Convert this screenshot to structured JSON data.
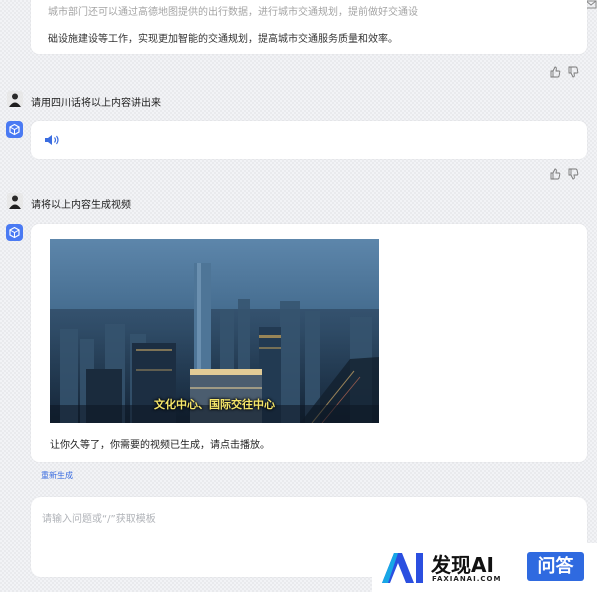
{
  "prev_reply": {
    "line1": "城市部门还可以通过高德地图提供的出行数据，进行城市交通规划，提前做好交通设",
    "line2": "础设施建设等工作，实现更加智能的交通规划，提高城市交通服务质量和效率。"
  },
  "messages": [
    {
      "role": "user",
      "text": "请用四川话将以上内容讲出来"
    },
    {
      "role": "user",
      "text": "请将以上内容生成视频"
    }
  ],
  "video": {
    "subtitle": "文化中心、国际交往中心",
    "caption": "让你久等了，你需要的视频已生成，请点击播放。"
  },
  "actions": {
    "regenerate": "重新生成"
  },
  "input": {
    "placeholder": "请输入问题或“/”获取模板"
  },
  "watermark": {
    "brand": "发现AI",
    "domain": "FAXIANAI.COM",
    "badge": "问答"
  },
  "colors": {
    "accent": "#3b6de0",
    "badge": "#2f6ae0"
  }
}
